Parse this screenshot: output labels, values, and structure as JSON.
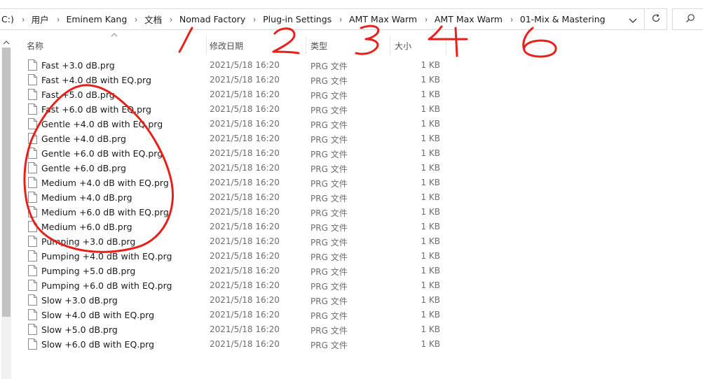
{
  "address_bar": {
    "crumbs": [
      "C:)",
      "用户",
      "Eminem Kang",
      "文档",
      "Nomad Factory",
      "Plug-in Settings",
      "AMT Max Warm",
      "AMT Max Warm",
      "01-Mix & Mastering"
    ],
    "separator": "›"
  },
  "columns": {
    "name": "名称",
    "date": "修改日期",
    "type": "类型",
    "size": "大小"
  },
  "files": [
    {
      "name": "Fast +3.0 dB.prg",
      "date": "2021/5/18 16:20",
      "type": "PRG 文件",
      "size": "1 KB"
    },
    {
      "name": "Fast +4.0 dB with EQ.prg",
      "date": "2021/5/18 16:20",
      "type": "PRG 文件",
      "size": "1 KB"
    },
    {
      "name": "Fast +5.0 dB.prg",
      "date": "2021/5/18 16:20",
      "type": "PRG 文件",
      "size": "1 KB"
    },
    {
      "name": "Fast +6.0 dB with EQ.prg",
      "date": "2021/5/18 16:20",
      "type": "PRG 文件",
      "size": "1 KB"
    },
    {
      "name": "Gentle +4.0 dB with EQ.prg",
      "date": "2021/5/18 16:20",
      "type": "PRG 文件",
      "size": "1 KB"
    },
    {
      "name": "Gentle +4.0 dB.prg",
      "date": "2021/5/18 16:20",
      "type": "PRG 文件",
      "size": "1 KB"
    },
    {
      "name": "Gentle +6.0 dB with EQ.prg",
      "date": "2021/5/18 16:20",
      "type": "PRG 文件",
      "size": "1 KB"
    },
    {
      "name": "Gentle +6.0 dB.prg",
      "date": "2021/5/18 16:20",
      "type": "PRG 文件",
      "size": "1 KB"
    },
    {
      "name": "Medium +4.0 dB with EQ.prg",
      "date": "2021/5/18 16:20",
      "type": "PRG 文件",
      "size": "1 KB"
    },
    {
      "name": "Medium +4.0 dB.prg",
      "date": "2021/5/18 16:20",
      "type": "PRG 文件",
      "size": "1 KB"
    },
    {
      "name": "Medium +6.0 dB with EQ.prg",
      "date": "2021/5/18 16:20",
      "type": "PRG 文件",
      "size": "1 KB"
    },
    {
      "name": "Medium +6.0 dB.prg",
      "date": "2021/5/18 16:20",
      "type": "PRG 文件",
      "size": "1 KB"
    },
    {
      "name": "Pumping +3.0 dB.prg",
      "date": "2021/5/18 16:20",
      "type": "PRG 文件",
      "size": "1 KB"
    },
    {
      "name": "Pumping +4.0 dB with EQ.prg",
      "date": "2021/5/18 16:20",
      "type": "PRG 文件",
      "size": "1 KB"
    },
    {
      "name": "Pumping +5.0 dB.prg",
      "date": "2021/5/18 16:20",
      "type": "PRG 文件",
      "size": "1 KB"
    },
    {
      "name": "Pumping +6.0 dB with EQ.prg",
      "date": "2021/5/18 16:20",
      "type": "PRG 文件",
      "size": "1 KB"
    },
    {
      "name": "Slow +3.0 dB.prg",
      "date": "2021/5/18 16:20",
      "type": "PRG 文件",
      "size": "1 KB"
    },
    {
      "name": "Slow +4.0 dB with EQ.prg",
      "date": "2021/5/18 16:20",
      "type": "PRG 文件",
      "size": "1 KB"
    },
    {
      "name": "Slow +5.0 dB.prg",
      "date": "2021/5/18 16:20",
      "type": "PRG 文件",
      "size": "1 KB"
    },
    {
      "name": "Slow +6.0 dB with EQ.prg",
      "date": "2021/5/18 16:20",
      "type": "PRG 文件",
      "size": "1 KB"
    }
  ],
  "annotations": {
    "color": "#e8201a",
    "numbers": [
      "1",
      "2",
      "3",
      "4",
      "6"
    ]
  },
  "icons": {
    "address_dropdown": "chevron-down-icon",
    "refresh": "refresh-icon",
    "search": "search-icon",
    "file": "file-icon",
    "scroll_up": "scroll-up-icon",
    "sort": "sort-arrow-icon"
  }
}
